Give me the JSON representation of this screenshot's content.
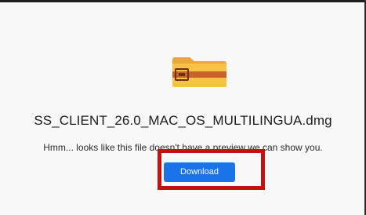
{
  "preview": {
    "file_name": "SS_CLIENT_26.0_MAC_OS_MULTILINGUA.dmg",
    "message": "Hmm... looks like this file doesn't have a preview we can show you.",
    "download_label": "Download",
    "icon": "folder-icon"
  },
  "colors": {
    "accent": "#1a73e8",
    "annotation": "#c0120f",
    "folder": "#f6c344",
    "folder_band": "#c8622a"
  }
}
